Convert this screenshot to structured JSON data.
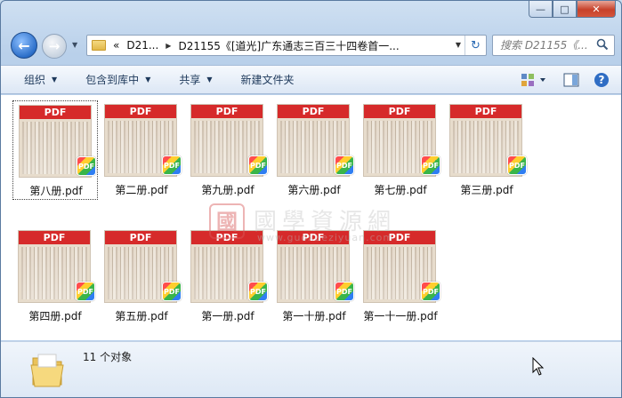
{
  "window": {
    "caption": {
      "minimize": "—",
      "maximize": "□",
      "close": "✕"
    }
  },
  "nav": {
    "back_icon": "back-arrow-icon",
    "forward_icon": "forward-arrow-icon",
    "history_dropdown": "▼",
    "breadcrumb": {
      "overflow": "«",
      "crumbs": [
        "D21...",
        "D21155《[道光]广东通志三百三十四卷首一..."
      ]
    },
    "search_placeholder": "搜索 D21155《..."
  },
  "toolbar": {
    "items": [
      "组织",
      "包含到库中",
      "共享",
      "新建文件夹"
    ],
    "has_dropdown": [
      true,
      true,
      true,
      false
    ],
    "dropdown_arrow": "▼"
  },
  "files": [
    {
      "name": "第八册.pdf",
      "badge": "PDF",
      "label": "PDF",
      "selected": true
    },
    {
      "name": "第二册.pdf",
      "badge": "PDF",
      "label": "PDF"
    },
    {
      "name": "第九册.pdf",
      "badge": "PDF",
      "label": "PDF"
    },
    {
      "name": "第六册.pdf",
      "badge": "PDF",
      "label": "PDF"
    },
    {
      "name": "第七册.pdf",
      "badge": "PDF",
      "label": "PDF"
    },
    {
      "name": "第三册.pdf",
      "badge": "PDF",
      "label": "PDF"
    },
    {
      "name": "第四册.pdf",
      "badge": "PDF",
      "label": "PDF"
    },
    {
      "name": "第五册.pdf",
      "badge": "PDF",
      "label": "PDF"
    },
    {
      "name": "第一册.pdf",
      "badge": "PDF",
      "label": "PDF"
    },
    {
      "name": "第一十册.pdf",
      "badge": "PDF",
      "label": "PDF"
    },
    {
      "name": "第一十一册.pdf",
      "badge": "PDF",
      "label": "PDF"
    }
  ],
  "watermark": {
    "seal": "國",
    "text": "國學資源網",
    "url": "www.guoxueziyuan.com"
  },
  "details": {
    "count": "11 个对象"
  },
  "colors": {
    "pdf_red": "#d62a2a",
    "toolbar_text": "#1e395b",
    "close_red": "#c7412a"
  }
}
